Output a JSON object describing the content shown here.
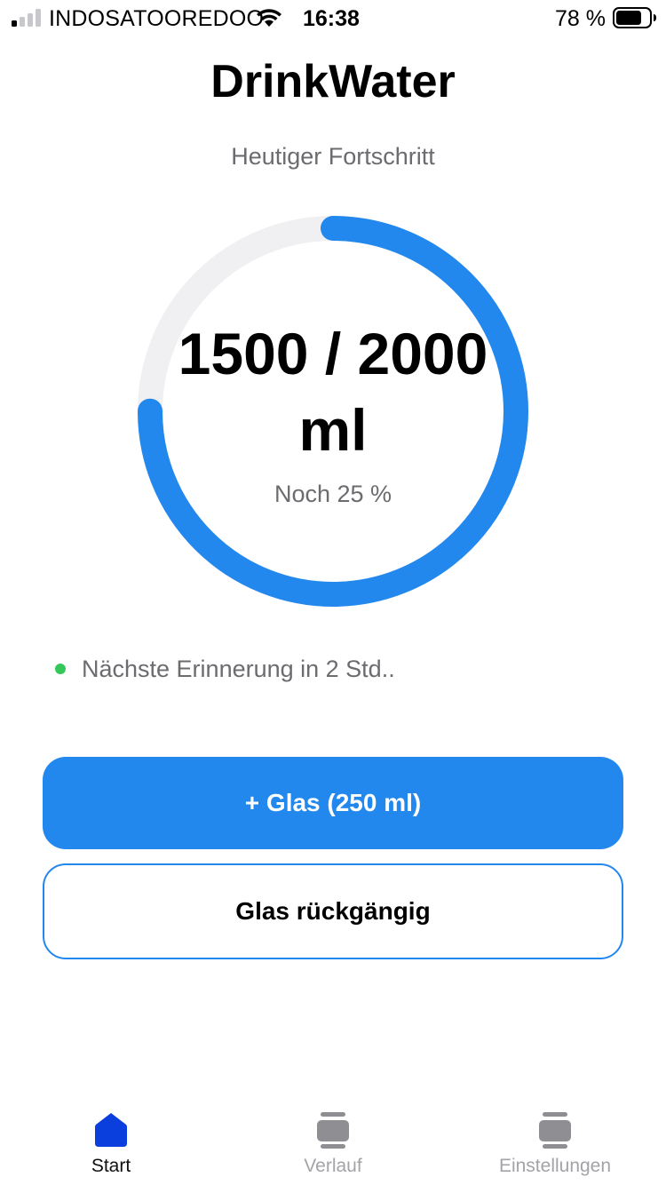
{
  "status_bar": {
    "carrier": "INDOSATOOREDOO",
    "time": "16:38",
    "battery_percent": "78 %",
    "battery_level": 0.78,
    "signal_bars_active": 1,
    "signal_bars_total": 4,
    "icons": [
      "signal-icon",
      "wifi-icon",
      "battery-icon"
    ]
  },
  "header": {
    "title": "DrinkWater",
    "subtitle": "Heutiger Fortschritt"
  },
  "progress": {
    "amount_line1": "1500 / 2000",
    "amount_line2": "ml",
    "remaining": "Noch 25 %",
    "current_ml": 1500,
    "goal_ml": 2000,
    "fraction": 0.75
  },
  "reminder": {
    "text": "Nächste Erinnerung in 2 Std..",
    "status_color": "#34c759"
  },
  "actions": {
    "add_glass_label": "+ Glas (250 ml)",
    "undo_glass_label": "Glas rückgängig"
  },
  "tab_bar": {
    "tabs": [
      {
        "label": "Start",
        "icon": "home-icon",
        "active": true
      },
      {
        "label": "Verlauf",
        "icon": "history-icon",
        "active": false
      },
      {
        "label": "Einstellungen",
        "icon": "settings-icon",
        "active": false
      }
    ]
  },
  "colors": {
    "accent": "#2288ee",
    "track": "#f0f0f2",
    "secondary_text": "#6b6b70",
    "tab_active": "#0a3fdd",
    "tab_inactive": "#8e8e93"
  }
}
